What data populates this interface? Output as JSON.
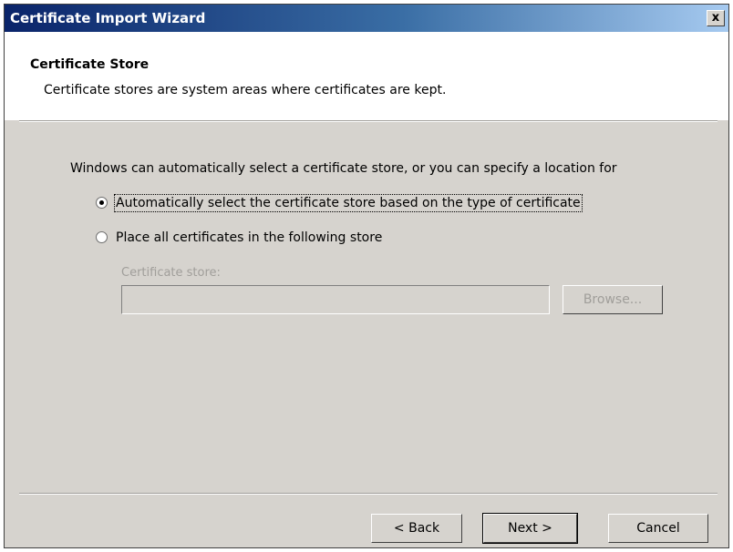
{
  "window": {
    "title": "Certificate Import Wizard",
    "close_label": "x"
  },
  "header": {
    "title": "Certificate Store",
    "subtitle": "Certificate stores are system areas where certificates are kept."
  },
  "body": {
    "intro": "Windows can automatically select a certificate store, or you can specify a location for",
    "options": [
      {
        "label": "Automatically select the certificate store based on the type of certificate",
        "checked": true
      },
      {
        "label": "Place all certificates in the following store",
        "checked": false
      }
    ],
    "store_label": "Certificate store:",
    "store_value": "",
    "browse_label": "Browse..."
  },
  "footer": {
    "back_label": "< Back",
    "next_label": "Next >",
    "cancel_label": "Cancel"
  }
}
